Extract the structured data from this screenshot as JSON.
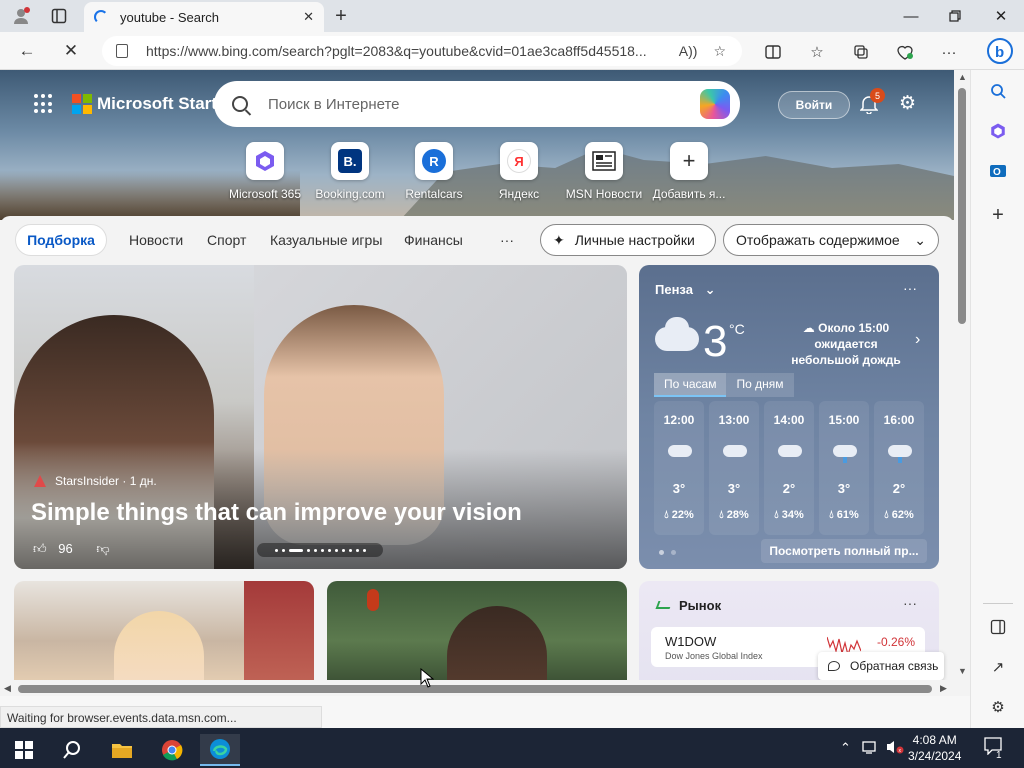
{
  "browser": {
    "tab_title": "youtube - Search",
    "url": "https://www.bing.com/search?pglt=2083&q=youtube&cvid=01ae3ca8ff5d45518...",
    "status": "Waiting for browser.events.data.msn.com..."
  },
  "header": {
    "brand": "Microsoft Start",
    "search_placeholder": "Поиск в Интернете",
    "signin_label": "Войти",
    "notification_count": "5"
  },
  "quicklinks": [
    {
      "label": "Microsoft 365"
    },
    {
      "label": "Booking.com"
    },
    {
      "label": "Rentalcars"
    },
    {
      "label": "Яндекс"
    },
    {
      "label": "MSN Новости"
    },
    {
      "label": "Добавить я..."
    }
  ],
  "feednav": {
    "active": "Подборка",
    "links": [
      "Новости",
      "Спорт",
      "Казуальные игры",
      "Финансы"
    ],
    "more": "···",
    "personalize": "Личные настройки",
    "display": "Отображать содержимое"
  },
  "story": {
    "source": "StarsInsider · 1 дн.",
    "title": "Simple things that can improve your vision",
    "likes": "96"
  },
  "weather": {
    "city": "Пенза",
    "temp": "3",
    "unit": "°C",
    "forecast": "Около 15:00 ожидается небольшой дождь",
    "tab_hourly": "По часам",
    "tab_daily": "По дням",
    "hours": [
      {
        "time": "12:00",
        "temp": "3°",
        "precip": "22%",
        "rain": false
      },
      {
        "time": "13:00",
        "temp": "3°",
        "precip": "28%",
        "rain": false
      },
      {
        "time": "14:00",
        "temp": "2°",
        "precip": "34%",
        "rain": false
      },
      {
        "time": "15:00",
        "temp": "3°",
        "precip": "61%",
        "rain": true
      },
      {
        "time": "16:00",
        "temp": "2°",
        "precip": "62%",
        "rain": true
      }
    ],
    "see_full": "Посмотреть полный пр..."
  },
  "market": {
    "title": "Рынок",
    "symbol": "W1DOW",
    "name": "Dow Jones Global Index",
    "change": "-0.26%"
  },
  "feedback": "Обратная связь",
  "taskbar": {
    "time": "4:08 AM",
    "date": "3/24/2024",
    "notif_count": "1"
  }
}
